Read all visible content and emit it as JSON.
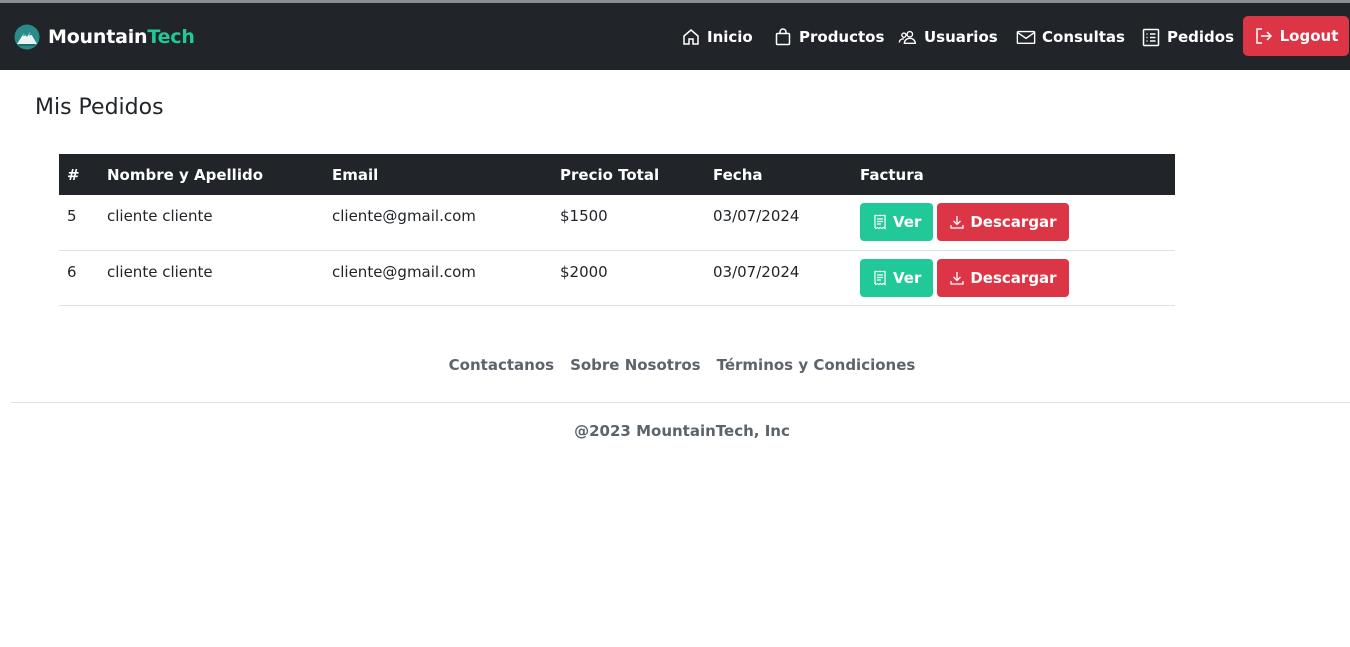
{
  "navbar": {
    "brand_main": "Mountain",
    "brand_accent": "Tech",
    "brand_logo_icon": "mountain-logo-icon",
    "colors": {
      "background": "#212529",
      "accent": "#20c997",
      "logout": "#dc3545"
    },
    "items": [
      {
        "label": "Inicio",
        "icon": "house-icon"
      },
      {
        "label": "Productos",
        "icon": "bag-icon"
      },
      {
        "label": "Usuarios",
        "icon": "people-icon"
      },
      {
        "label": "Consultas",
        "icon": "envelope-icon"
      },
      {
        "label": "Pedidos",
        "icon": "list-icon"
      }
    ],
    "logout_label": "Logout",
    "logout_icon": "logout-icon"
  },
  "main": {
    "title": "Mis Pedidos",
    "table": {
      "columns": [
        "#",
        "Nombre y Apellido",
        "Email",
        "Precio Total",
        "Fecha",
        "Factura"
      ],
      "rows": [
        {
          "id": "5",
          "name": "cliente cliente",
          "email": "cliente@gmail.com",
          "total": "$1500",
          "date": "03/07/2024",
          "view_label": "Ver",
          "download_label": "Descargar"
        },
        {
          "id": "6",
          "name": "cliente cliente",
          "email": "cliente@gmail.com",
          "total": "$2000",
          "date": "03/07/2024",
          "view_label": "Ver",
          "download_label": "Descargar"
        }
      ],
      "view_icon": "receipt-icon",
      "download_icon": "download-icon",
      "colors": {
        "view": "#20c997",
        "download": "#dc3545"
      }
    }
  },
  "footer": {
    "links": [
      "Contactanos",
      "Sobre Nosotros",
      "Términos y Condiciones"
    ],
    "copyright": "@2023 MountainTech, Inc"
  }
}
